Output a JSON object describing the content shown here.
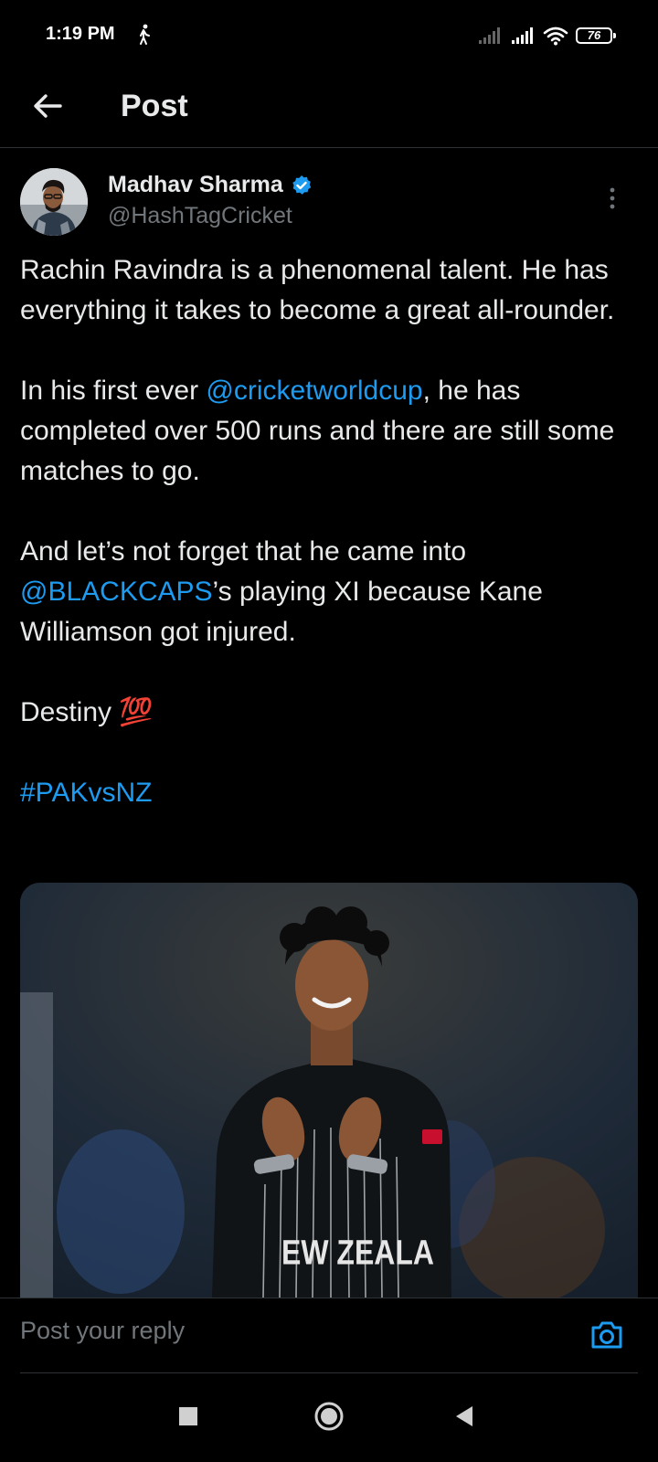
{
  "status_bar": {
    "time": "1:19 PM",
    "battery": "76"
  },
  "header": {
    "title": "Post"
  },
  "author": {
    "name": "Madhav Sharma",
    "handle": "@HashTagCricket"
  },
  "post": {
    "p1": "Rachin Ravindra is a phenomenal talent. He has everything it takes to become a great all-rounder.",
    "p2_before": "In his first ever ",
    "p2_mention": "@cricketworldcup",
    "p2_after": ", he has completed over 500 runs and there are still some matches to go.",
    "p3_before": "And let’s not forget that he came into ",
    "p3_mention": "@BLACKCAPS",
    "p3_after": "’s playing XI because Kane Williamson got injured.",
    "p4": "Destiny 💯",
    "hashtag": "#PAKvsNZ"
  },
  "reply": {
    "placeholder": "Post your reply"
  },
  "colors": {
    "background": "#000000",
    "text": "#e7e9ea",
    "secondary": "#71767b",
    "link": "#1d9bf0",
    "verified": "#1d9bf0"
  },
  "icons": {
    "back": "arrow-left-icon",
    "verified": "verified-badge-icon",
    "more": "more-vertical-icon",
    "camera": "camera-icon",
    "nav_recents": "square-icon",
    "nav_home": "circle-icon",
    "nav_back": "triangle-back-icon"
  }
}
